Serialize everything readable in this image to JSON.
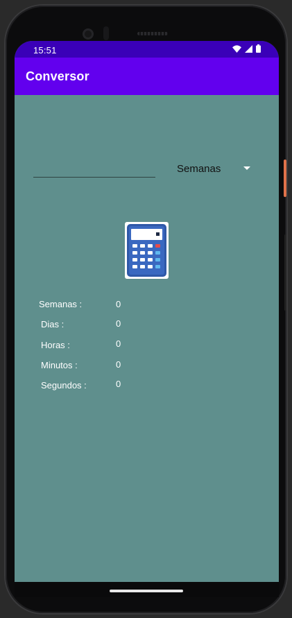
{
  "status_bar": {
    "time": "15:51",
    "icons": [
      "wifi-icon",
      "signal-icon",
      "battery-icon"
    ]
  },
  "app_bar": {
    "title": "Conversor"
  },
  "form": {
    "input_value": "",
    "unit_selected": "Semanas"
  },
  "calculate_button": {
    "icon": "calculator-icon"
  },
  "results": [
    {
      "label": "Semanas :",
      "value": "0"
    },
    {
      "label": "Dias :",
      "value": "0"
    },
    {
      "label": "Horas :",
      "value": "0"
    },
    {
      "label": "Minutos :",
      "value": "0"
    },
    {
      "label": "Segundos :",
      "value": "0"
    }
  ],
  "colors": {
    "status_bar": "#3a00b8",
    "app_bar": "#6200ee",
    "background": "#5f8f8d",
    "text": "#ffffff"
  }
}
